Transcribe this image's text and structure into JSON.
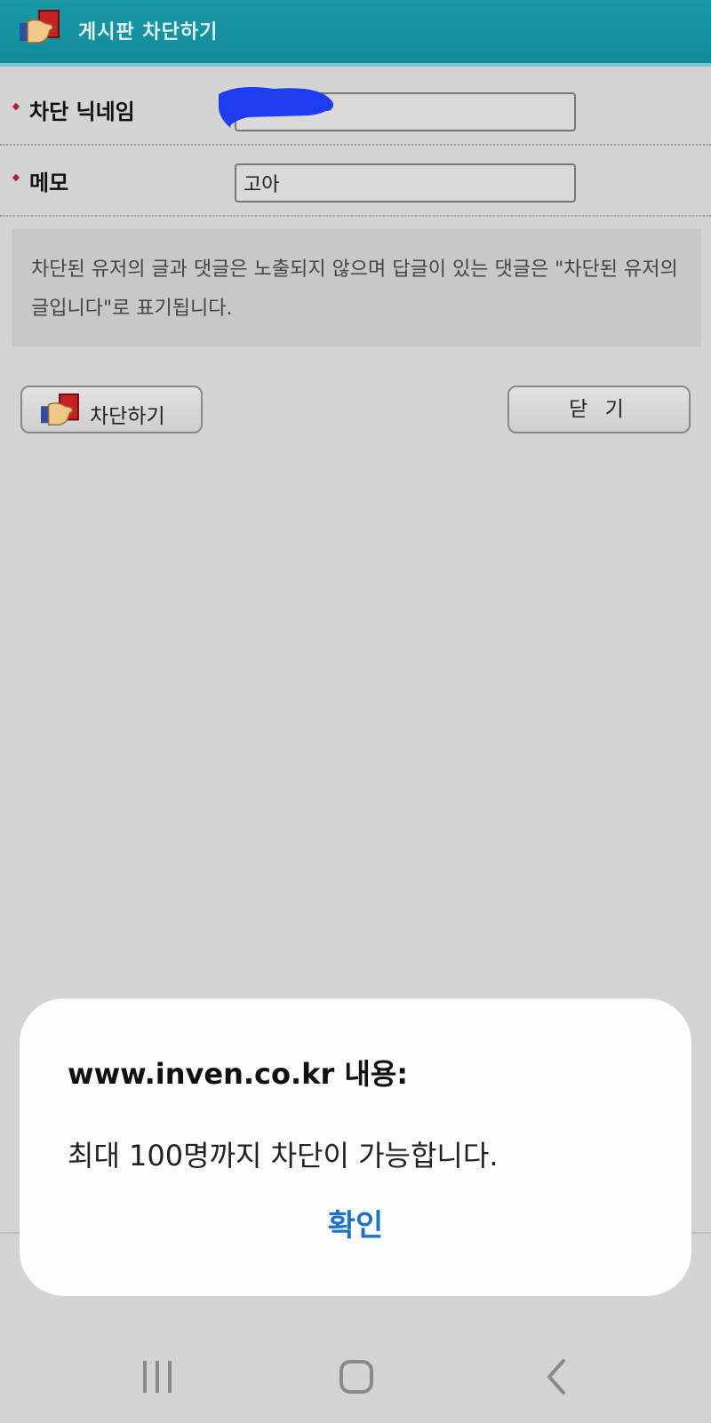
{
  "header": {
    "title": "게시판 차단하기",
    "icon": "hand-red-card-icon"
  },
  "form": {
    "nickname_label": "차단 닉네임",
    "nickname_value": "",
    "memo_label": "메모",
    "memo_value": "고아"
  },
  "notice": "차단된 유저의 글과 댓글은 노출되지 않으며 답글이 있는 댓글은 \"차단된 유저의 글입니다\"로 표기됩니다.",
  "buttons": {
    "block_label": "차단하기",
    "close_label": "닫 기"
  },
  "dialog": {
    "title": "www.inven.co.kr 내용:",
    "message": "최대 100명까지 차단이 가능합니다.",
    "ok_label": "확인"
  },
  "colors": {
    "header_bg": "#1a98a6",
    "dialog_ok": "#1a73c8",
    "redaction": "#1f3cf0"
  },
  "navbar": {
    "icons": [
      "recent-apps-icon",
      "home-icon",
      "back-icon"
    ]
  }
}
